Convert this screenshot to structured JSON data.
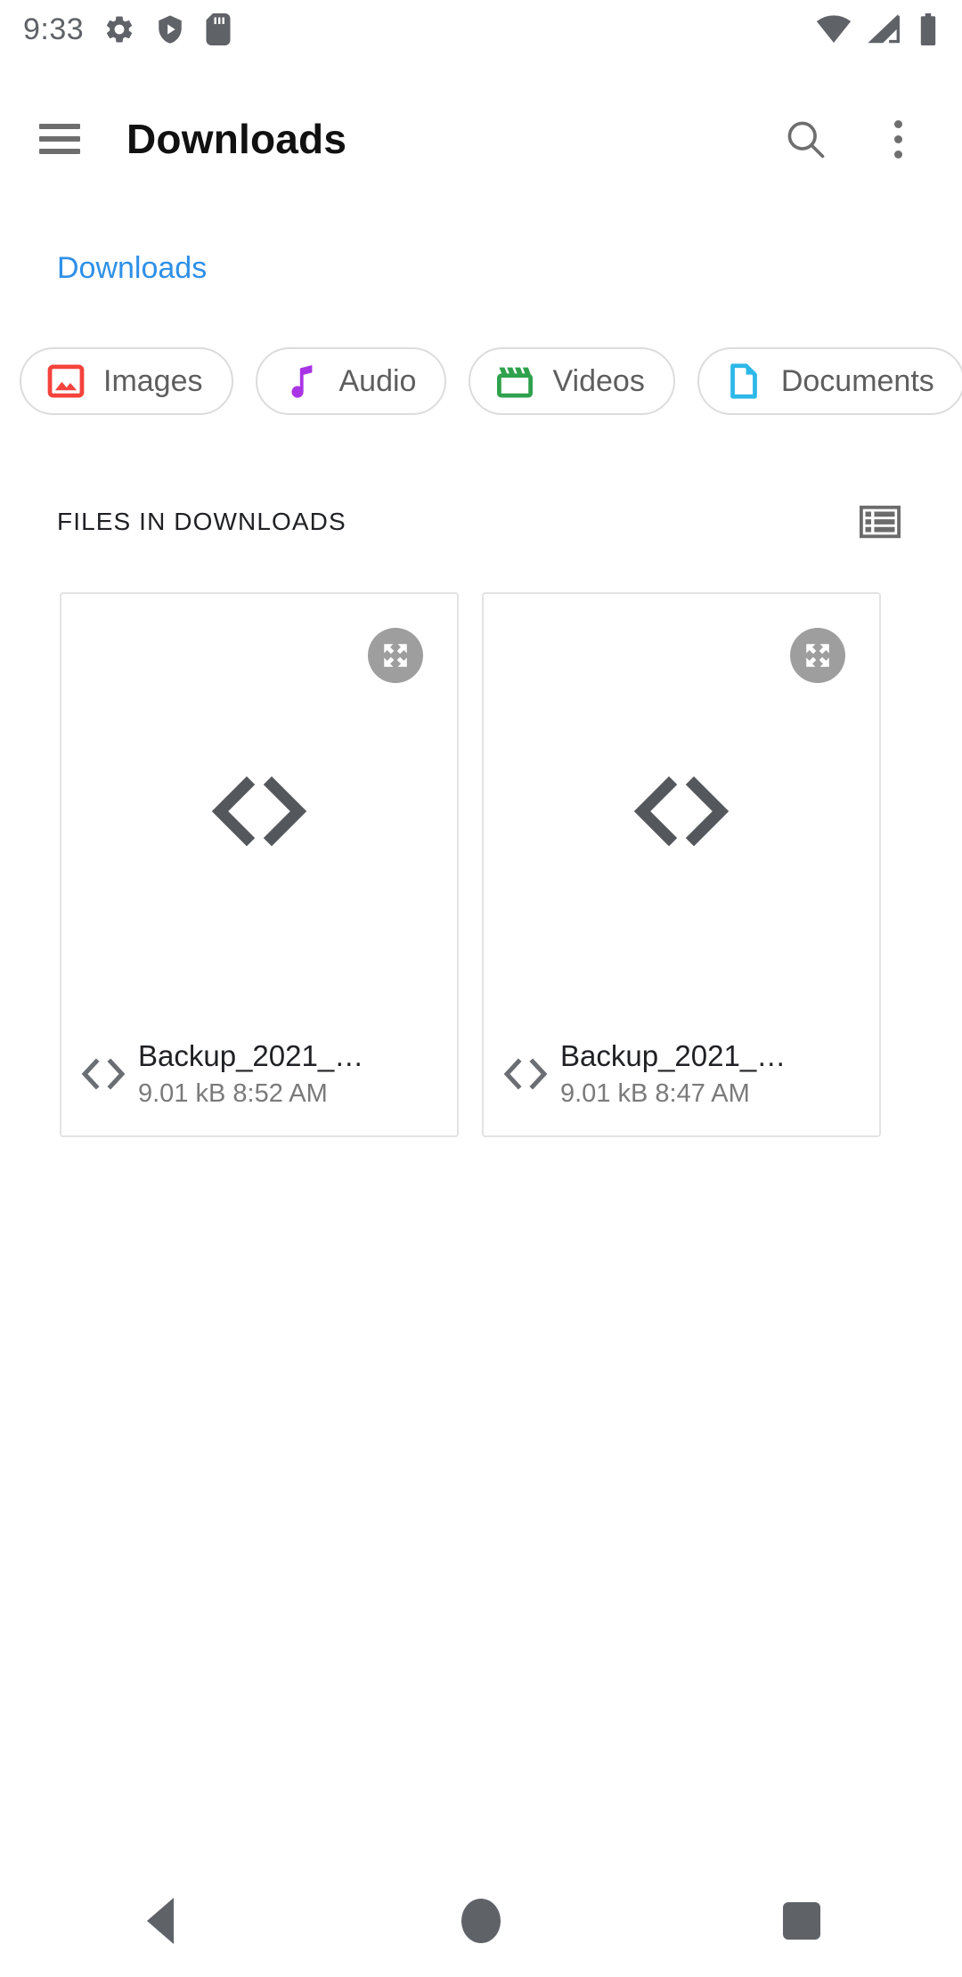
{
  "status_bar": {
    "clock": "9:33",
    "left_icons": [
      "settings-gear-icon",
      "play-protect-icon",
      "sd-card-icon"
    ],
    "right_icons": [
      "wifi-icon",
      "cellular-signal-icon",
      "battery-icon"
    ]
  },
  "app_bar": {
    "menu_icon": "hamburger-menu-icon",
    "title": "Downloads",
    "search_icon": "search-icon",
    "overflow_icon": "more-options-icon"
  },
  "breadcrumb": {
    "label": "Downloads"
  },
  "filter_chips": [
    {
      "label": "Images",
      "icon": "image-icon",
      "color": "#F4433C"
    },
    {
      "label": "Audio",
      "icon": "music-note-icon",
      "color": "#A934E6"
    },
    {
      "label": "Videos",
      "icon": "clapperboard-icon",
      "color": "#2FA14D"
    },
    {
      "label": "Documents",
      "icon": "document-icon",
      "color": "#2DB8E8"
    }
  ],
  "section": {
    "title": "FILES IN DOWNLOADS",
    "view_toggle_icon": "list-view-icon"
  },
  "files": [
    {
      "name": "Backup_2021_…",
      "size": "9.01 kB",
      "time": "8:52 AM",
      "meta": "9.01 kB 8:52 AM",
      "thumb_icon": "code-brackets-icon",
      "expand_icon": "expand-fullscreen-icon"
    },
    {
      "name": "Backup_2021_…",
      "size": "9.01 kB",
      "time": "8:47 AM",
      "meta": "9.01 kB 8:47 AM",
      "thumb_icon": "code-brackets-icon",
      "expand_icon": "expand-fullscreen-icon"
    }
  ],
  "nav_bar": {
    "back": "back-button",
    "home": "home-button",
    "recents": "recents-button"
  },
  "colors": {
    "accent_blue": "#2e90e8",
    "icon_gray": "#5f6368",
    "text_primary": "#202124",
    "text_secondary": "#7a7a7a",
    "card_border": "#e3e3e3"
  }
}
